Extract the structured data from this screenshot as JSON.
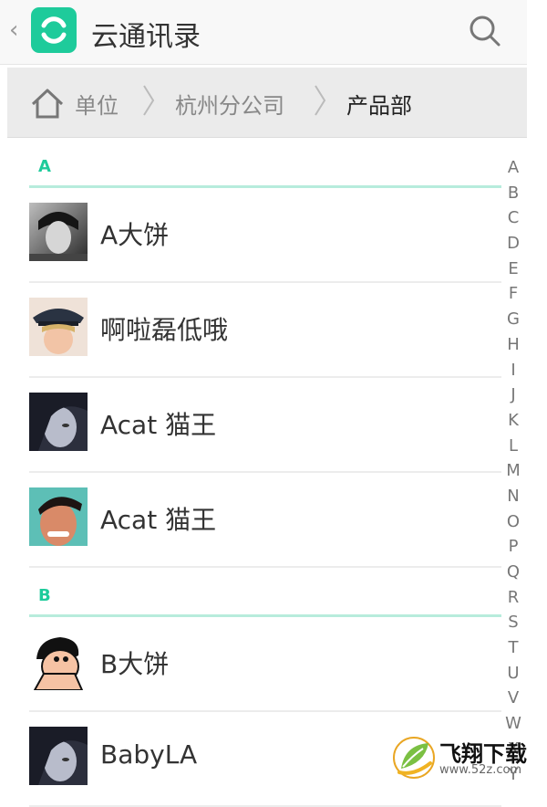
{
  "header": {
    "back": "‹",
    "title": "云通讯录"
  },
  "breadcrumb": [
    "单位",
    "杭州分公司",
    "产品部"
  ],
  "sections": [
    {
      "letter": "A",
      "contacts": [
        "A大饼",
        "啊啦磊低哦",
        "Acat 猫王",
        "Acat 猫王"
      ]
    },
    {
      "letter": "B",
      "contacts": [
        "B大饼",
        "BabyLA"
      ]
    }
  ],
  "index": [
    "A",
    "B",
    "C",
    "D",
    "E",
    "F",
    "G",
    "H",
    "I",
    "J",
    "K",
    "L",
    "M",
    "N",
    "O",
    "P",
    "Q",
    "R",
    "S",
    "T",
    "U",
    "V",
    "W",
    "X",
    "Y"
  ],
  "watermark": {
    "text": "飞翔下载",
    "url": "www.52z.com"
  },
  "colors": {
    "accent": "#1ecb9b"
  }
}
